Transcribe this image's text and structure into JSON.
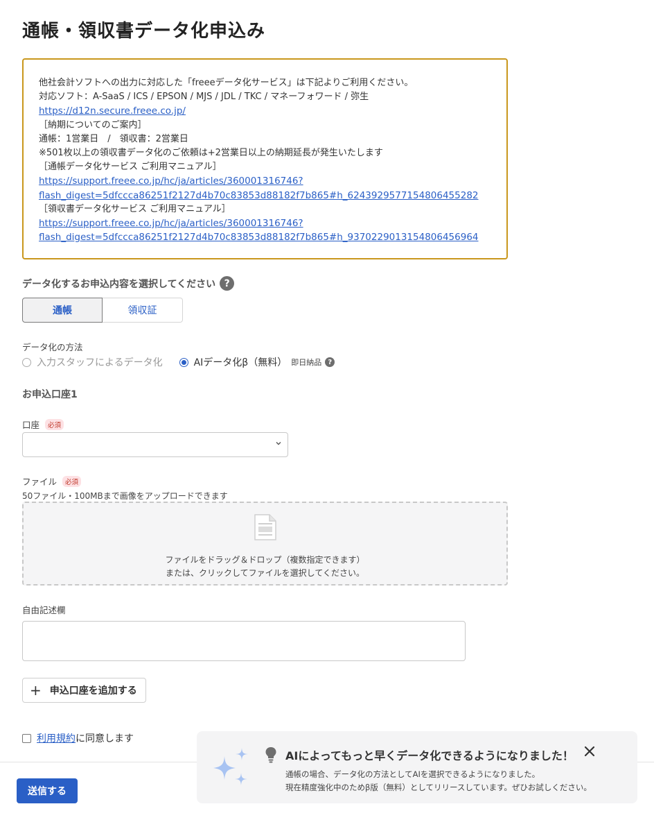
{
  "page": {
    "title": "通帳・領収書データ化申込み"
  },
  "notice": {
    "intro": "他社会計ソフトへの出力に対応した「freeeデータ化サービス」は下記よりご利用ください。",
    "supported": "対応ソフト：A-SaaS / ICS / EPSON / MJS / JDL / TKC / マネーフォワード / 弥生",
    "service_link": "https://d12n.secure.freee.co.jp/",
    "delivery_heading": "［納期についてのご案内］",
    "delivery_days": "通帳：1営業日　/　領収書：2営業日",
    "delivery_note": "※501枚以上の領収書データ化のご依頼は+2営業日以上の納期延長が発生いたします",
    "passbook_manual_heading": "［通帳データ化サービス ご利用マニュアル］",
    "passbook_manual_link_1": "https://support.freee.co.jp/hc/ja/articles/360001316746?",
    "passbook_manual_link_2": "flash_digest=5dfccca86251f2127d4b70c83853d88182f7b865#h_6243929577154806455282",
    "receipt_manual_heading": "［領収書データ化サービス ご利用マニュアル］",
    "receipt_manual_link_1": "https://support.freee.co.jp/hc/ja/articles/360001316746?",
    "receipt_manual_link_2": "flash_digest=5dfccca86251f2127d4b70c83853d88182f7b865#h_9370229013154806456964"
  },
  "content_select": {
    "label": "データ化するお申込内容を選択してください",
    "help_icon": "question-circle-icon",
    "options": [
      "通帳",
      "領収証"
    ],
    "selected": "通帳"
  },
  "method": {
    "label": "データ化の方法",
    "option_staff": "入力スタッフによるデータ化",
    "option_ai": "AIデータ化β（無料）",
    "ai_note": "即日納品",
    "selected": "AIデータ化β（無料）"
  },
  "account_section": {
    "heading": "お申込口座1",
    "account_label": "口座",
    "required_badge": "必須",
    "account_value": ""
  },
  "file": {
    "label": "ファイル",
    "required_badge": "必須",
    "limit_note": "50ファイル・100MBまで画像をアップロードできます",
    "drop_line1": "ファイルをドラッグ＆ドロップ（複数指定できます）",
    "drop_line2": "または、クリックしてファイルを選択してください。"
  },
  "memo": {
    "label": "自由記述欄",
    "value": ""
  },
  "add_account_button": "申込口座を追加する",
  "agree": {
    "link": "利用規約",
    "text": "に同意します"
  },
  "submit_button": "送信する",
  "toast": {
    "title": "AIによってもっと早くデータ化できるようになりました！",
    "line1": "通帳の場合、データ化の方法としてAIを選択できるようになりました。",
    "line2": "現在精度強化中のためβ版（無料）としてリリースしています。ぜひお試しください。"
  },
  "colors": {
    "accent": "#2a5fc6",
    "notice_border": "#c9971c",
    "required": "#c0392b"
  }
}
